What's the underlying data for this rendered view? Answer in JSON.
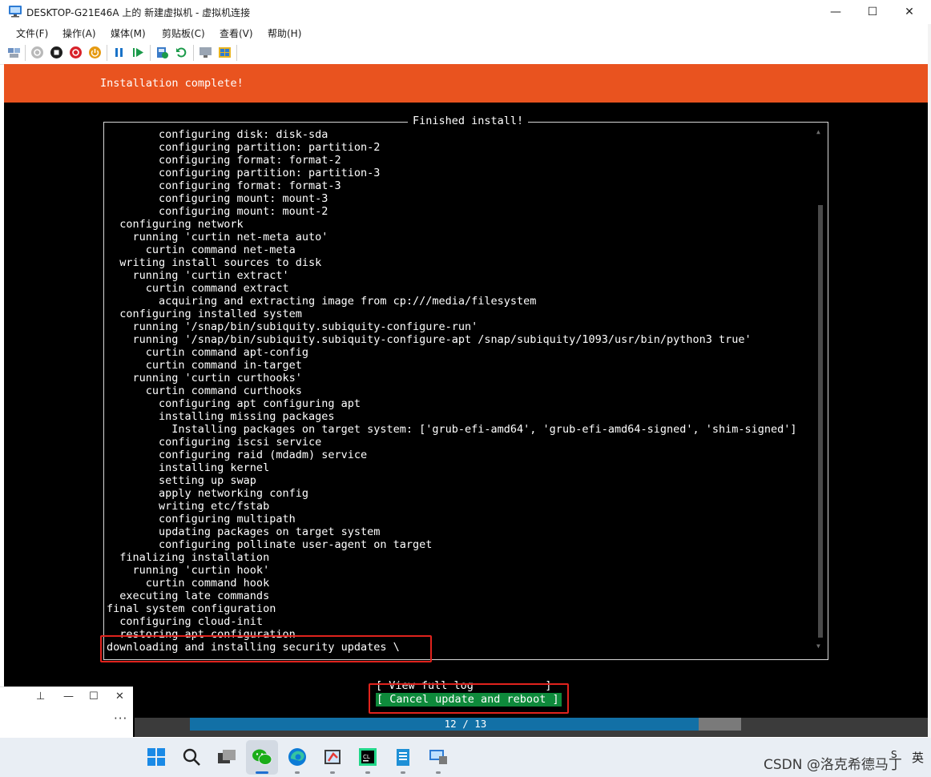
{
  "window": {
    "title": "DESKTOP-G21E46A 上的 新建虚拟机 - 虚拟机连接",
    "controls": {
      "minimize": "—",
      "maximize": "☐",
      "close": "✕"
    }
  },
  "menu": [
    "文件(F)",
    "操作(A)",
    "媒体(M)",
    "剪贴板(C)",
    "查看(V)",
    "帮助(H)"
  ],
  "toolbar_icons": [
    "ctrl-alt-del-icon",
    "start-icon",
    "turn-off-icon",
    "shutdown-icon",
    "power-icon",
    "pause-icon",
    "resume-icon",
    "checkpoint-icon",
    "revert-icon",
    "enhanced-session-icon",
    "basic-session-icon"
  ],
  "vm": {
    "banner": "Installation complete!",
    "frame_title": "Finished install!",
    "log_lines": [
      "        configuring disk: disk-sda",
      "        configuring partition: partition-2",
      "        configuring format: format-2",
      "        configuring partition: partition-3",
      "        configuring format: format-3",
      "        configuring mount: mount-3",
      "        configuring mount: mount-2",
      "  configuring network",
      "    running 'curtin net-meta auto'",
      "      curtin command net-meta",
      "  writing install sources to disk",
      "    running 'curtin extract'",
      "      curtin command extract",
      "        acquiring and extracting image from cp:///media/filesystem",
      "  configuring installed system",
      "    running '/snap/bin/subiquity.subiquity-configure-run'",
      "    running '/snap/bin/subiquity.subiquity-configure-apt /snap/subiquity/1093/usr/bin/python3 true'",
      "      curtin command apt-config",
      "      curtin command in-target",
      "    running 'curtin curthooks'",
      "      curtin command curthooks",
      "        configuring apt configuring apt",
      "        installing missing packages",
      "          Installing packages on target system: ['grub-efi-amd64', 'grub-efi-amd64-signed', 'shim-signed']",
      "        configuring iscsi service",
      "        configuring raid (mdadm) service",
      "        installing kernel",
      "        setting up swap",
      "        apply networking config",
      "        writing etc/fstab",
      "        configuring multipath",
      "        updating packages on target system",
      "        configuring pollinate user-agent on target",
      "  finalizing installation",
      "    running 'curtin hook'",
      "      curtin command hook",
      "  executing late commands",
      "final system configuration",
      "  configuring cloud-init",
      "  restoring apt configuration",
      "downloading and installing security updates \\"
    ],
    "buttons": {
      "view_log": "[ View full log           ]",
      "cancel": "[ Cancel update and reboot ]"
    },
    "progress": {
      "text": "12 / 13",
      "current": 12,
      "total": 13
    }
  },
  "mini_window": {
    "pin": "⊥",
    "minimize": "—",
    "maximize": "☐",
    "close": "✕",
    "more": "···"
  },
  "taskbar": {
    "apps": [
      "windows-start-icon",
      "search-icon",
      "task-view-icon",
      "wechat-icon",
      "edge-icon",
      "paint-icon",
      "clion-icon",
      "app-icon",
      "hyperv-icon"
    ],
    "watermark": "CSDN @洛克希德马丁",
    "ime": "英",
    "ime_mode": "S"
  },
  "colors": {
    "banner": "#e9531f",
    "cancel_button": "#0e8a3b",
    "progress": "#1270a6",
    "highlight": "#e0231d"
  }
}
